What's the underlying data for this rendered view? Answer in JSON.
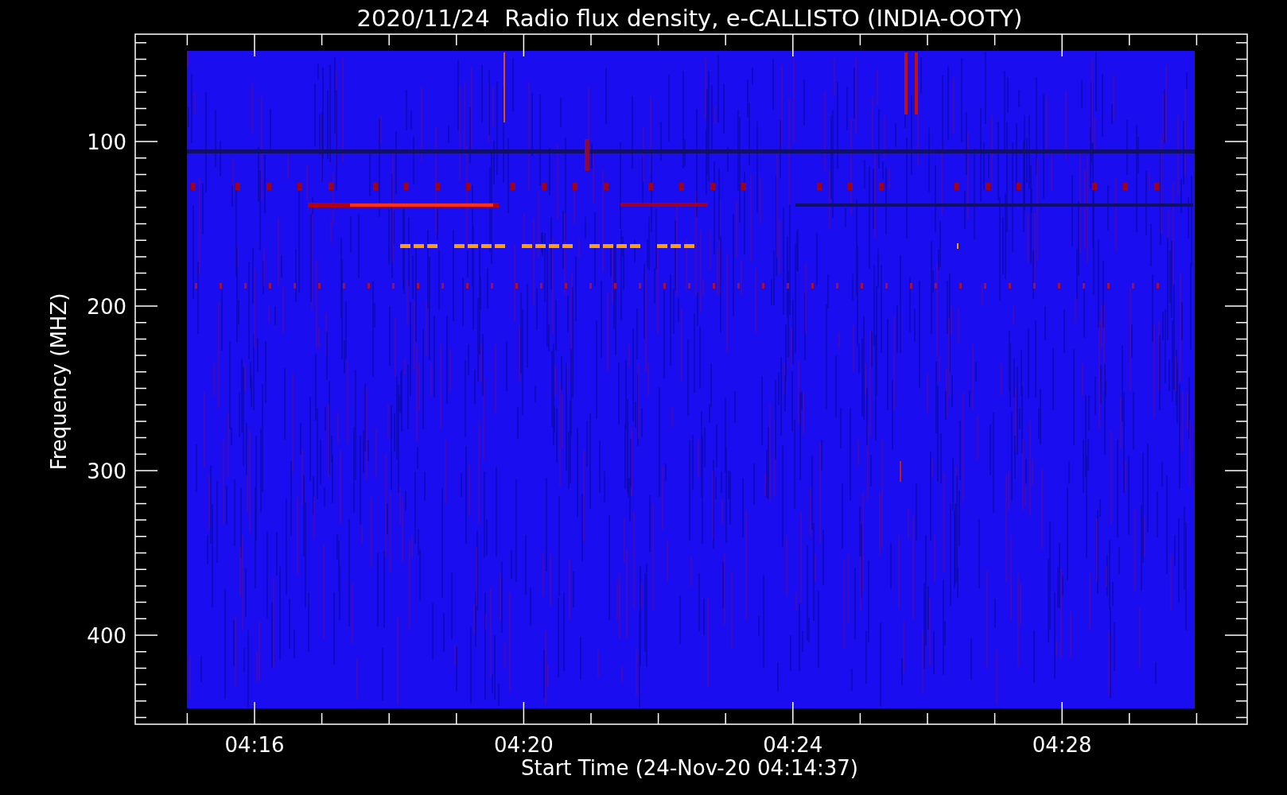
{
  "title": "2020/11/24  Radio flux density, e-CALLISTO (INDIA-OOTY)",
  "xlabel": "Start Time (24-Nov-20 04:14:37)",
  "ylabel": "Frequency (MHZ)",
  "xticks": [
    "04:16",
    "04:20",
    "04:24",
    "04:28"
  ],
  "yticks": [
    "100",
    "200",
    "300",
    "400"
  ]
}
